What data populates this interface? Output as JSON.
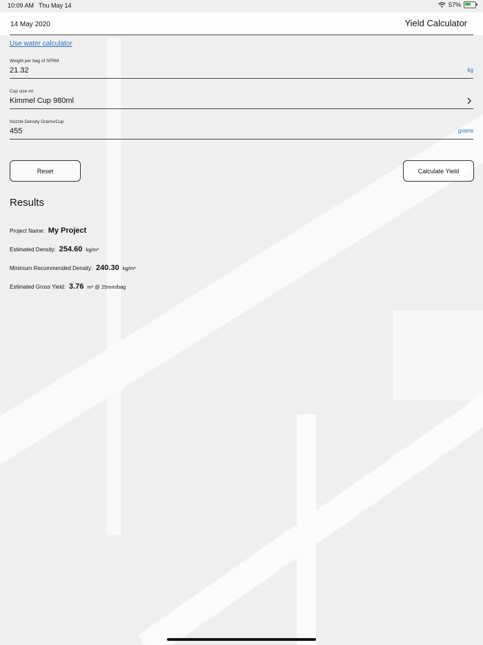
{
  "status_bar": {
    "time": "10:09 AM",
    "date": "Thu May 14",
    "battery": "57%"
  },
  "header": {
    "date": "14 May 2020",
    "title": "Yield Calculator"
  },
  "water_calculator_link": "Use water calculator",
  "fields": [
    {
      "label": "Weight per bag of SFRM",
      "value": "21.32",
      "unit": "kg"
    },
    {
      "label": "Cup size ml",
      "value": "Kimmel Cup 980ml"
    },
    {
      "label": "Nozzle Density Grams/Cup",
      "value": "455",
      "unit": "grams"
    }
  ],
  "buttons": {
    "reset": "Reset",
    "calculate": "Calculate Yield"
  },
  "results": {
    "title": "Results",
    "rows": [
      {
        "label": "Project Name:",
        "value": "My Project",
        "unit": ""
      },
      {
        "label": "Estimated Density:",
        "value": "254.60",
        "unit": "kg/m³"
      },
      {
        "label": "Minimum Recommended Density:",
        "value": "240.30",
        "unit": "kg/m³"
      },
      {
        "label": "Estimated Gross Yield:",
        "value": "3.76",
        "unit": "m² @ 25mm/bag"
      }
    ]
  }
}
